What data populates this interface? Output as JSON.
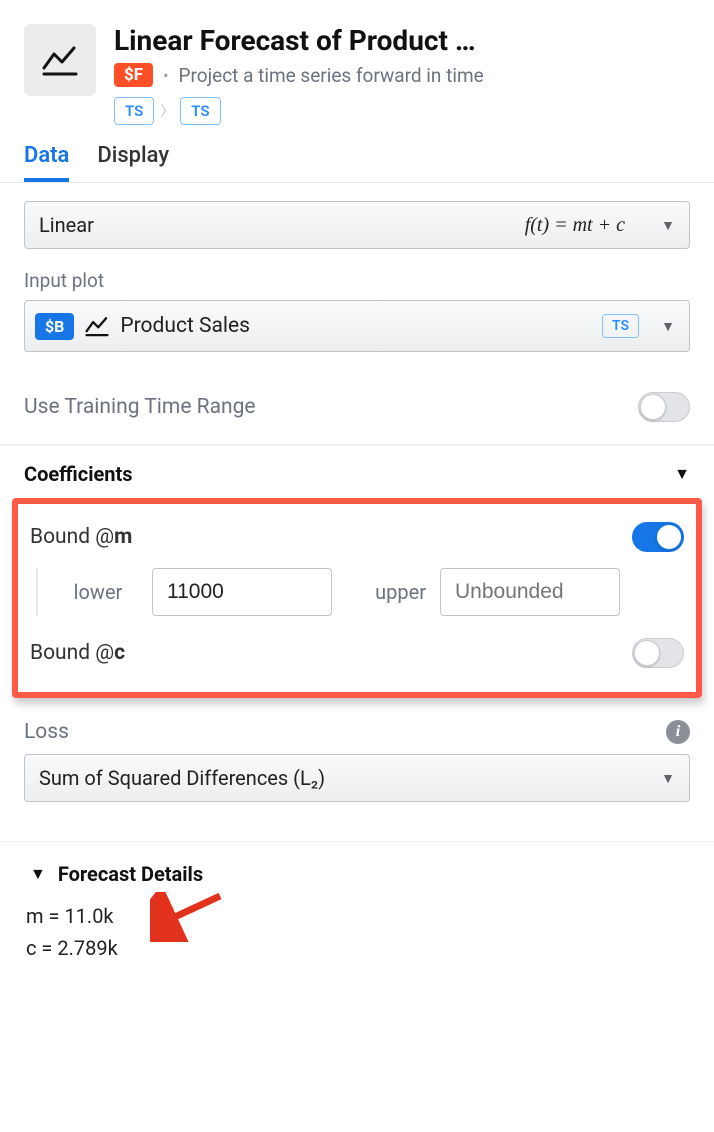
{
  "header": {
    "title": "Linear Forecast of Product …",
    "badge": "$F",
    "description": "Project a time series forward in time",
    "type_chips": [
      "TS",
      "TS"
    ]
  },
  "tabs": {
    "data": "Data",
    "display": "Display",
    "active": "data"
  },
  "model_select": {
    "value": "Linear",
    "formula": "f(t) = mt + c"
  },
  "input_plot": {
    "label": "Input plot",
    "badge": "$B",
    "name": "Product Sales",
    "chip": "TS"
  },
  "training_range": {
    "label": "Use Training Time Range",
    "enabled": false
  },
  "coefficients": {
    "title": "Coefficients",
    "bound_m": {
      "label_prefix": "Bound @",
      "label_var": "m",
      "enabled": true,
      "lower_label": "lower",
      "lower_value": "11000",
      "upper_label": "upper",
      "upper_placeholder": "Unbounded"
    },
    "bound_c": {
      "label_prefix": "Bound @",
      "label_var": "c",
      "enabled": false
    }
  },
  "loss": {
    "label": "Loss",
    "value": "Sum of Squared Differences (L₂)"
  },
  "forecast_details": {
    "title": "Forecast Details",
    "lines": [
      "m = 11.0k",
      "c = 2.789k"
    ]
  }
}
